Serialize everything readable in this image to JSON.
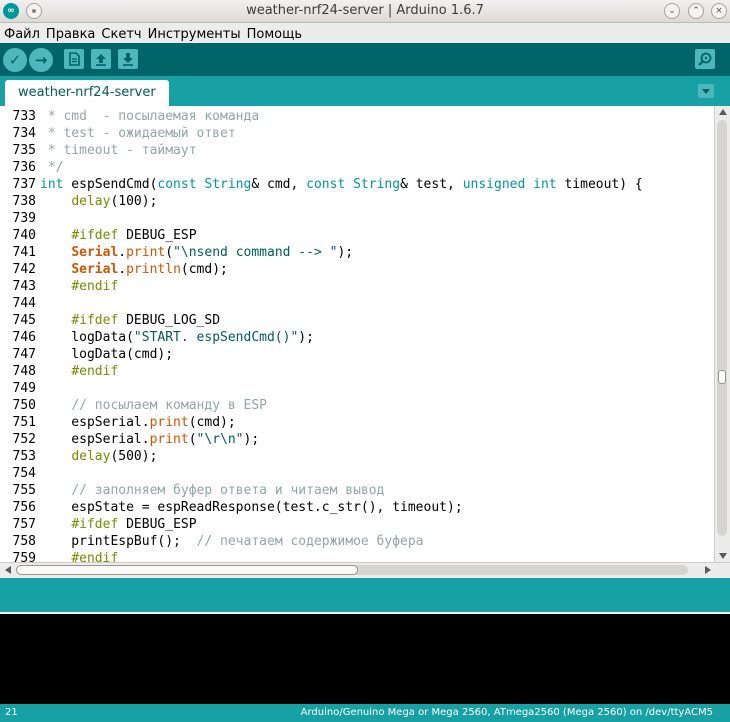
{
  "window": {
    "title": "weather-nrf24-server | Arduino 1.6.7",
    "app_icon_glyph": "∞",
    "buttons": [
      "minimize-icon",
      "maximize-icon",
      "close-icon"
    ],
    "minimize_glyph": "⌄",
    "maximize_glyph": "⌃",
    "close_glyph": "×"
  },
  "menu": {
    "items": [
      "Файл",
      "Правка",
      "Скетч",
      "Инструменты",
      "Помощь"
    ]
  },
  "toolbar": {
    "verify_glyph": "✓",
    "upload_glyph": "→",
    "buttons": [
      "verify",
      "upload",
      "new",
      "open",
      "save",
      "serial-monitor"
    ]
  },
  "tabs": {
    "active": "weather-nrf24-server"
  },
  "editor": {
    "lines": [
      {
        "n": "733",
        "parts": [
          [
            " * cmd  - посылаемая команда",
            "comment"
          ]
        ]
      },
      {
        "n": "734",
        "parts": [
          [
            " * test - ожидаемый ответ",
            "comment"
          ]
        ]
      },
      {
        "n": "735",
        "parts": [
          [
            " * timeout - таймаут",
            "comment"
          ]
        ]
      },
      {
        "n": "736",
        "parts": [
          [
            " */",
            "comment"
          ]
        ]
      },
      {
        "n": "737",
        "parts": [
          [
            "int",
            "type"
          ],
          [
            " espSendCmd(",
            ""
          ],
          [
            "const",
            "type"
          ],
          [
            " ",
            ""
          ],
          [
            "String",
            "type"
          ],
          [
            "& cmd, ",
            ""
          ],
          [
            "const",
            "type"
          ],
          [
            " ",
            ""
          ],
          [
            "String",
            "type"
          ],
          [
            "& test, ",
            ""
          ],
          [
            "unsigned",
            "type"
          ],
          [
            " ",
            ""
          ],
          [
            "int",
            "type"
          ],
          [
            " timeout) {",
            ""
          ]
        ]
      },
      {
        "n": "738",
        "parts": [
          [
            "    ",
            ""
          ],
          [
            "delay",
            "kw"
          ],
          [
            "(100);",
            ""
          ]
        ]
      },
      {
        "n": "739",
        "parts": []
      },
      {
        "n": "740",
        "parts": [
          [
            "    ",
            ""
          ],
          [
            "#ifdef",
            "pp"
          ],
          [
            " DEBUG_ESP",
            ""
          ]
        ]
      },
      {
        "n": "741",
        "parts": [
          [
            "    ",
            ""
          ],
          [
            "Serial",
            "obj"
          ],
          [
            ".",
            ""
          ],
          [
            "print",
            "fn2"
          ],
          [
            "(",
            ""
          ],
          [
            "\"\\nsend command --> \"",
            "str"
          ],
          [
            ");",
            ""
          ]
        ]
      },
      {
        "n": "742",
        "parts": [
          [
            "    ",
            ""
          ],
          [
            "Serial",
            "obj"
          ],
          [
            ".",
            ""
          ],
          [
            "println",
            "fn2"
          ],
          [
            "(cmd);",
            ""
          ]
        ]
      },
      {
        "n": "743",
        "parts": [
          [
            "    ",
            ""
          ],
          [
            "#endif",
            "pp"
          ]
        ]
      },
      {
        "n": "744",
        "parts": []
      },
      {
        "n": "745",
        "parts": [
          [
            "    ",
            ""
          ],
          [
            "#ifdef",
            "pp"
          ],
          [
            " DEBUG_LOG_SD",
            ""
          ]
        ]
      },
      {
        "n": "746",
        "parts": [
          [
            "    logData(",
            ""
          ],
          [
            "\"START. espSendCmd()\"",
            "str"
          ],
          [
            ");",
            ""
          ]
        ]
      },
      {
        "n": "747",
        "parts": [
          [
            "    logData(cmd);",
            ""
          ]
        ]
      },
      {
        "n": "748",
        "parts": [
          [
            "    ",
            ""
          ],
          [
            "#endif",
            "pp"
          ]
        ]
      },
      {
        "n": "749",
        "parts": []
      },
      {
        "n": "750",
        "parts": [
          [
            "    ",
            ""
          ],
          [
            "// посылаем команду в ESP",
            "comment"
          ]
        ]
      },
      {
        "n": "751",
        "parts": [
          [
            "    espSerial.",
            ""
          ],
          [
            "print",
            "fn2"
          ],
          [
            "(cmd);",
            ""
          ]
        ]
      },
      {
        "n": "752",
        "parts": [
          [
            "    espSerial.",
            ""
          ],
          [
            "print",
            "fn2"
          ],
          [
            "(",
            ""
          ],
          [
            "\"\\r\\n\"",
            "str"
          ],
          [
            ");",
            ""
          ]
        ]
      },
      {
        "n": "753",
        "parts": [
          [
            "    ",
            ""
          ],
          [
            "delay",
            "kw"
          ],
          [
            "(500);",
            ""
          ]
        ]
      },
      {
        "n": "754",
        "parts": []
      },
      {
        "n": "755",
        "parts": [
          [
            "    ",
            ""
          ],
          [
            "// заполняем буфер ответа и читаем вывод",
            "comment"
          ]
        ]
      },
      {
        "n": "756",
        "parts": [
          [
            "    espState = espReadResponse(test.c_str(), timeout);",
            ""
          ]
        ]
      },
      {
        "n": "757",
        "parts": [
          [
            "    ",
            ""
          ],
          [
            "#ifdef",
            "pp"
          ],
          [
            " DEBUG_ESP",
            ""
          ]
        ]
      },
      {
        "n": "758",
        "parts": [
          [
            "    printEspBuf();  ",
            ""
          ],
          [
            "// печатаем содержимое буфера",
            "comment"
          ]
        ]
      },
      {
        "n": "759",
        "parts": [
          [
            "    ",
            ""
          ],
          [
            "#endif",
            "pp"
          ]
        ]
      }
    ]
  },
  "status": {
    "line": "21",
    "board": "Arduino/Genuino Mega or Mega 2560, ATmega2560 (Mega 2560) on /dev/ttyACM5"
  },
  "colors": {
    "toolbar": "#006468",
    "accent": "#17a1a5",
    "console": "#000000"
  }
}
